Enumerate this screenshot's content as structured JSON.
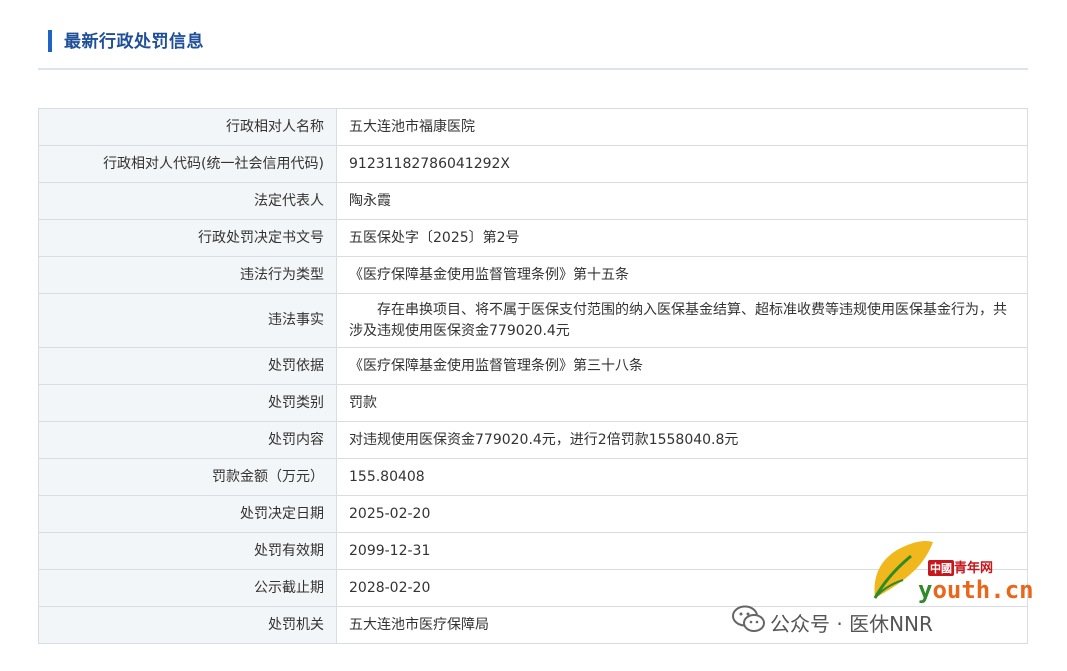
{
  "header": {
    "title": "最新行政处罚信息"
  },
  "table": {
    "rows": [
      {
        "label": "行政相对人名称",
        "value": "五大连池市福康医院"
      },
      {
        "label": "行政相对人代码(统一社会信用代码)",
        "value": "91231182786041292X"
      },
      {
        "label": "法定代表人",
        "value": "陶永霞"
      },
      {
        "label": "行政处罚决定书文号",
        "value": "五医保处字〔2025〕第2号"
      },
      {
        "label": "违法行为类型",
        "value": "《医疗保障基金使用监督管理条例》第十五条"
      },
      {
        "label": "违法事实",
        "value": "　　存在串换项目、将不属于医保支付范围的纳入医保基金结算、超标准收费等违规使用医保基金行为，共涉及违规使用医保资金779020.4元"
      },
      {
        "label": "处罚依据",
        "value": "《医疗保障基金使用监督管理条例》第三十八条"
      },
      {
        "label": "处罚类别",
        "value": "罚款"
      },
      {
        "label": "处罚内容",
        "value": "对违规使用医保资金779020.4元，进行2倍罚款1558040.8元"
      },
      {
        "label": "罚款金额（万元）",
        "value": "155.80408"
      },
      {
        "label": "处罚决定日期",
        "value": "2025-02-20"
      },
      {
        "label": "处罚有效期",
        "value": "2099-12-31"
      },
      {
        "label": "公示截止期",
        "value": "2028-02-20"
      },
      {
        "label": "处罚机关",
        "value": "五大连池市医疗保障局"
      }
    ]
  },
  "watermark": {
    "brand_cn": "中國",
    "brand_name": "青年网",
    "domain_y": "y",
    "domain_rest": "outh.cn",
    "account": "公众号 · 医休NNR",
    "icons": [
      "ginkgo-leaf-icon",
      "wechat-icon"
    ],
    "colors": {
      "brand_red": "#c8161d",
      "domain_orange": "#e8671c",
      "leaf_green": "#2f8a28"
    }
  }
}
